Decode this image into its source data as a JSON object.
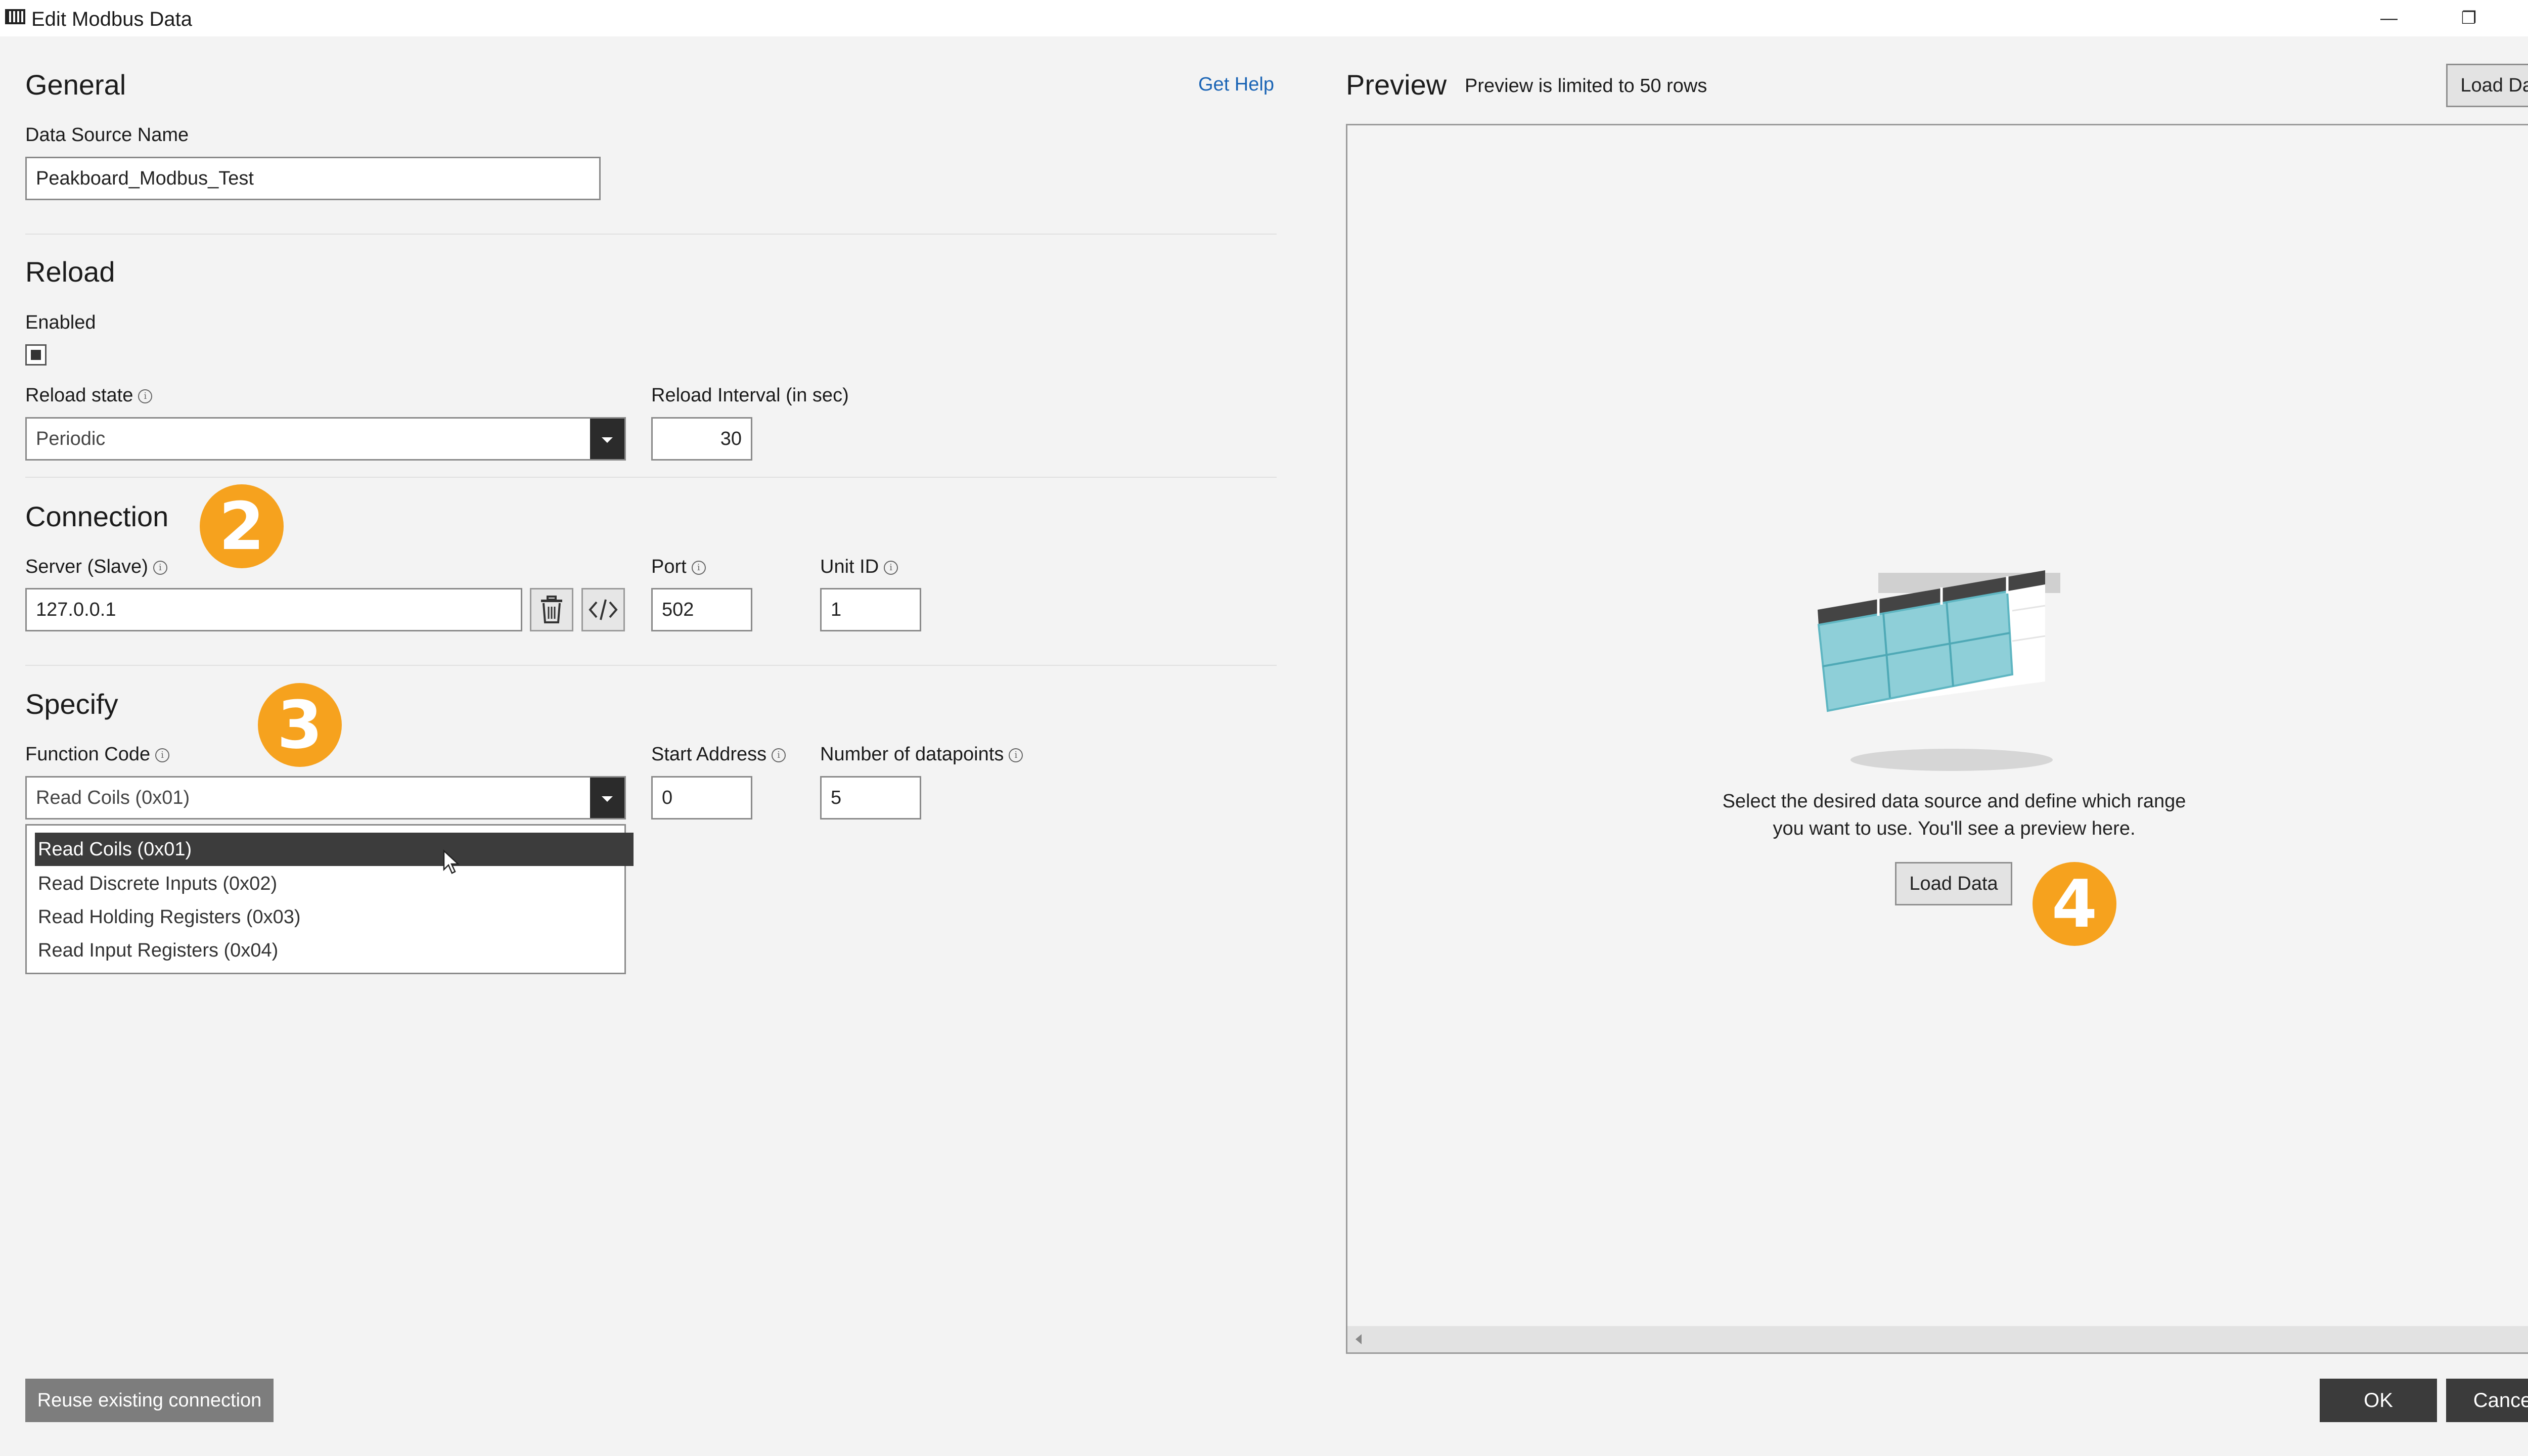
{
  "window": {
    "title": "Edit Modbus Data",
    "controls": {
      "minimize": "—",
      "restore": "❐",
      "close": "✕"
    }
  },
  "general": {
    "heading": "General",
    "help_link": "Get Help",
    "data_source_label": "Data Source Name",
    "data_source_value": "Peakboard_Modbus_Test"
  },
  "reload": {
    "heading": "Reload",
    "enabled_label": "Enabled",
    "enabled_checked": true,
    "state_label": "Reload state",
    "state_value": "Periodic",
    "interval_label": "Reload Interval (in sec)",
    "interval_value": "30"
  },
  "connection": {
    "heading": "Connection",
    "badge": "2",
    "server_label": "Server (Slave)",
    "server_value": "127.0.0.1",
    "port_label": "Port",
    "port_value": "502",
    "unit_label": "Unit ID",
    "unit_value": "1"
  },
  "specify": {
    "heading": "Specify",
    "badge": "3",
    "function_label": "Function Code",
    "function_value": "Read Coils (0x01)",
    "start_label": "Start Address",
    "start_value": "0",
    "datapoints_label": "Number of datapoints",
    "datapoints_value": "5",
    "options": [
      "Read Coils (0x01)",
      "Read Discrete Inputs (0x02)",
      "Read Holding Registers (0x03)",
      "Read Input Registers (0x04)"
    ],
    "selected_option": "Read Coils (0x01)"
  },
  "preview": {
    "heading": "Preview",
    "note": "Preview is limited to 50 rows",
    "load_top": "Load Data",
    "message_line1": "Select the desired data source and define which range",
    "message_line2": "you want to use. You'll see a preview here.",
    "load_center": "Load Data",
    "badge": "4"
  },
  "footer": {
    "reuse": "Reuse existing connection",
    "ok": "OK",
    "cancel": "Cancel"
  },
  "colors": {
    "accent_badge": "#f6a21e",
    "dark_button": "#3b3b3b",
    "link": "#1a64b5",
    "table_cyan": "#8ecfd8"
  }
}
